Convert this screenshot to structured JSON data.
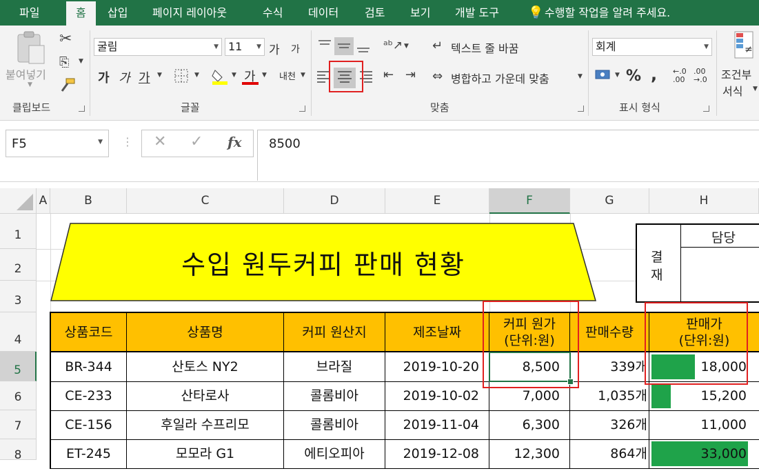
{
  "menu": {
    "tabs": [
      "파일",
      "홈",
      "삽입",
      "페이지 레이아웃",
      "수식",
      "데이터",
      "검토",
      "보기",
      "개발 도구"
    ],
    "tell_me": "수행할 작업을 알려 주세요."
  },
  "ribbon": {
    "clipboard": {
      "paste_label": "붙여넣기",
      "group_label": "클립보드"
    },
    "font": {
      "font_name": "굴림",
      "font_size": "11",
      "grow": "가",
      "shrink": "가",
      "bold": "가",
      "italic": "가",
      "underline": "가",
      "font_color_glyph": "가",
      "phonetic": "내천",
      "group_label": "글꼴"
    },
    "alignment": {
      "wrap_text": "텍스트 줄 바꿈",
      "merge_center": "병합하고 가운데 맞춤",
      "group_label": "맞춤"
    },
    "number": {
      "format": "회계",
      "percent": "%",
      "comma": ",",
      "inc_decimal": "←.0 .00",
      "dec_decimal": ".00 →.0",
      "group_label": "표시 형식"
    },
    "styles": {
      "conditional": "조건부",
      "conditional2": "서식"
    }
  },
  "formula_bar": {
    "name_box": "F5",
    "fx": "fx",
    "value": "8500"
  },
  "grid": {
    "columns": [
      "A",
      "B",
      "C",
      "D",
      "E",
      "F",
      "G",
      "H"
    ],
    "rows": [
      "1",
      "2",
      "3",
      "4",
      "5",
      "6",
      "7",
      "8"
    ],
    "title": "수입 원두커피 판매 현황",
    "approval": {
      "label1": "결",
      "label2": "재",
      "head": "담당"
    },
    "headers": [
      "상품코드",
      "상품명",
      "커피 원산지",
      "제조날짜",
      "커피 원가",
      "(단위:원)",
      "판매수량",
      "판매가",
      "(단위:원)"
    ],
    "data_rows": [
      {
        "code": "BR-344",
        "name": "산토스 NY2",
        "origin": "브라질",
        "date": "2019-10-20",
        "cost": "8,500",
        "qty": "339개",
        "price": "18,000",
        "bar": 0.45
      },
      {
        "code": "CE-233",
        "name": "산타로사",
        "origin": "콜롬비아",
        "date": "2019-10-02",
        "cost": "7,000",
        "qty": "1,035개",
        "price": "15,200",
        "bar": 0.2
      },
      {
        "code": "CE-156",
        "name": "후일라 수프리모",
        "origin": "콜롬비아",
        "date": "2019-11-04",
        "cost": "6,300",
        "qty": "326개",
        "price": "11,000",
        "bar": 0.0
      },
      {
        "code": "ET-245",
        "name": "모모라 G1",
        "origin": "에티오피아",
        "date": "2019-12-08",
        "cost": "12,300",
        "qty": "864개",
        "price": "33,000",
        "bar": 1.0
      }
    ]
  }
}
